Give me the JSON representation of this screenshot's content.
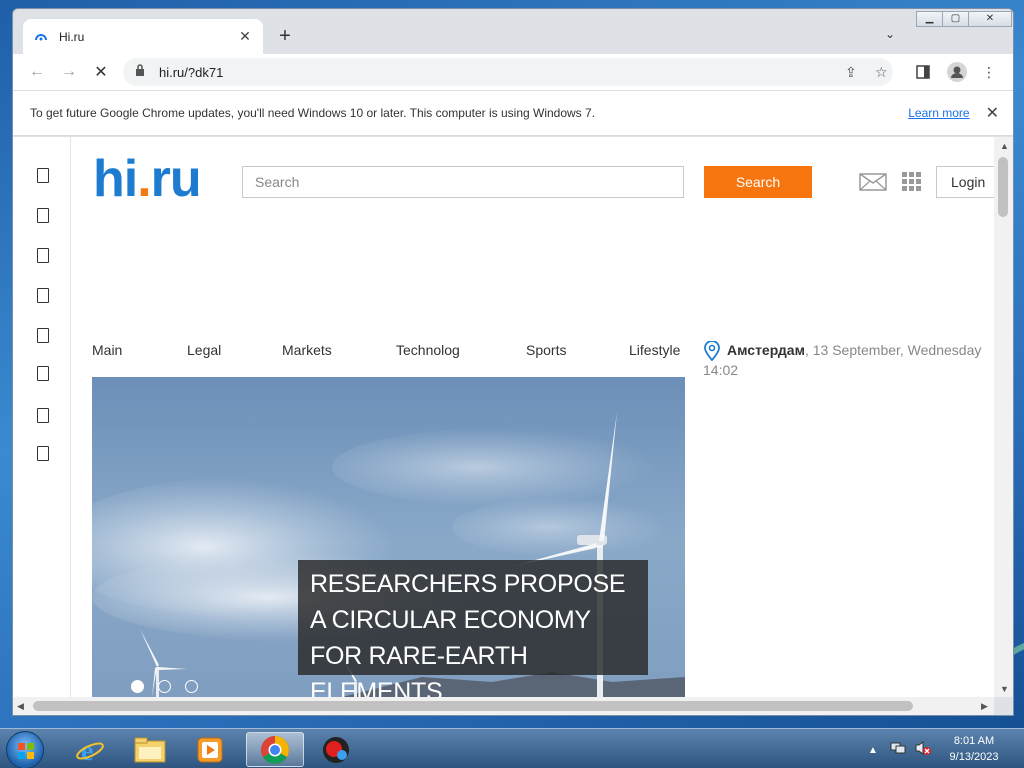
{
  "browser": {
    "tab_title": "Hi.ru",
    "url": "hi.ru/?dk71",
    "infobar_message": "To get future Google Chrome updates, you'll need Windows 10 or later. This computer is using Windows 7.",
    "infobar_link": "Learn more"
  },
  "site": {
    "logo_hi": "hi",
    "logo_dot": ".",
    "logo_ru": "ru",
    "search_placeholder": "Search",
    "search_button": "Search",
    "login_button": "Login",
    "nav": [
      "Main",
      "Legal",
      "Markets",
      "Technolog",
      "Sports",
      "Lifestyle"
    ],
    "weather": {
      "city": "Амстердам",
      "date": ", 13 September, Wednesday",
      "time": "14:02"
    },
    "hero": {
      "headline": "RESEARCHERS PROPOSE A CIRCULAR ECONOMY FOR RARE-EARTH ELEMENTS",
      "slides": 3,
      "active_slide": 1
    }
  },
  "taskbar": {
    "time": "8:01 AM",
    "date": "9/13/2023"
  },
  "colors": {
    "brand_blue": "#1e7cd0",
    "brand_orange": "#f07a13",
    "search_button": "#f7750f"
  }
}
